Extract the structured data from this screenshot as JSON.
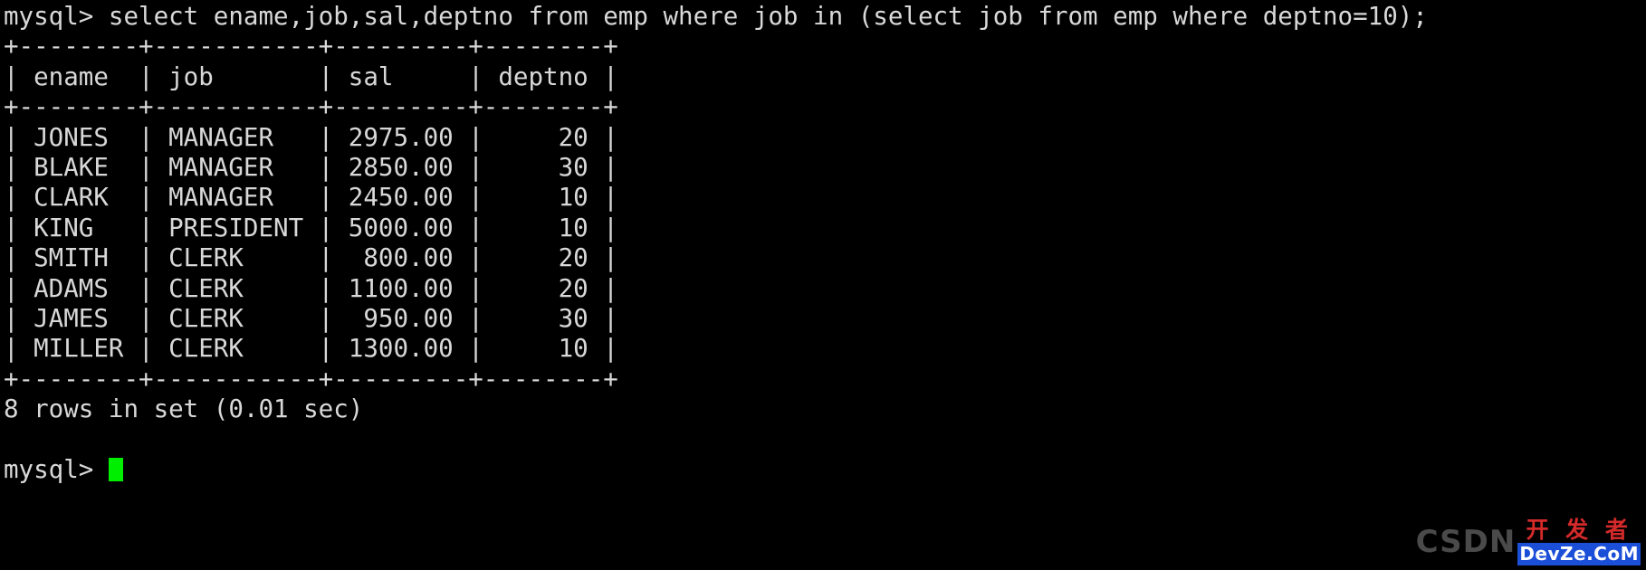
{
  "terminal": {
    "prompt": "mysql>",
    "command": " select ename,job,sal,deptno from emp where job in (select job from emp where deptno=10);",
    "command_line": "mysql> select ename,job,sal,deptno from emp where job in (select job from emp where deptno=10);",
    "separator_top": "+--------+-----------+---------+--------+",
    "header_row": "| ename  | job       | sal     | deptno |",
    "separator_mid": "+--------+-----------+---------+--------+",
    "rows_text": [
      "| JONES  | MANAGER   | 2975.00 |     20 |",
      "| BLAKE  | MANAGER   | 2850.00 |     30 |",
      "| CLARK  | MANAGER   | 2450.00 |     10 |",
      "| KING   | PRESIDENT | 5000.00 |     10 |",
      "| SMITH  | CLERK     |  800.00 |     20 |",
      "| ADAMS  | CLERK     | 1100.00 |     20 |",
      "| JAMES  | CLERK     |  950.00 |     30 |",
      "| MILLER | CLERK     | 1300.00 |     10 |"
    ],
    "separator_bottom": "+--------+-----------+---------+--------+",
    "status_line": "8 rows in set (0.01 sec)",
    "blank_line": " ",
    "final_prompt": "mysql> ",
    "cursor_color": "#00ee00",
    "foreground_color": "#d8d8d8",
    "background_color": "#000000"
  },
  "result_table": {
    "columns": [
      "ename",
      "job",
      "sal",
      "deptno"
    ],
    "rows": [
      [
        "JONES",
        "MANAGER",
        "2975.00",
        "20"
      ],
      [
        "BLAKE",
        "MANAGER",
        "2850.00",
        "30"
      ],
      [
        "CLARK",
        "MANAGER",
        "2450.00",
        "10"
      ],
      [
        "KING",
        "PRESIDENT",
        "5000.00",
        "10"
      ],
      [
        "SMITH",
        "CLERK",
        "800.00",
        "20"
      ],
      [
        "ADAMS",
        "CLERK",
        "1100.00",
        "20"
      ],
      [
        "JAMES",
        "CLERK",
        "950.00",
        "30"
      ],
      [
        "MILLER",
        "CLERK",
        "1300.00",
        "10"
      ]
    ],
    "row_count": 8,
    "elapsed": "0.01 sec"
  },
  "watermark": {
    "csdn_label": "CSDN",
    "cn_text": "开 发 者",
    "en_text": "DevZe.CoM",
    "cn_color": "#d42a2a",
    "en_bg_color": "#1c4fd8"
  }
}
